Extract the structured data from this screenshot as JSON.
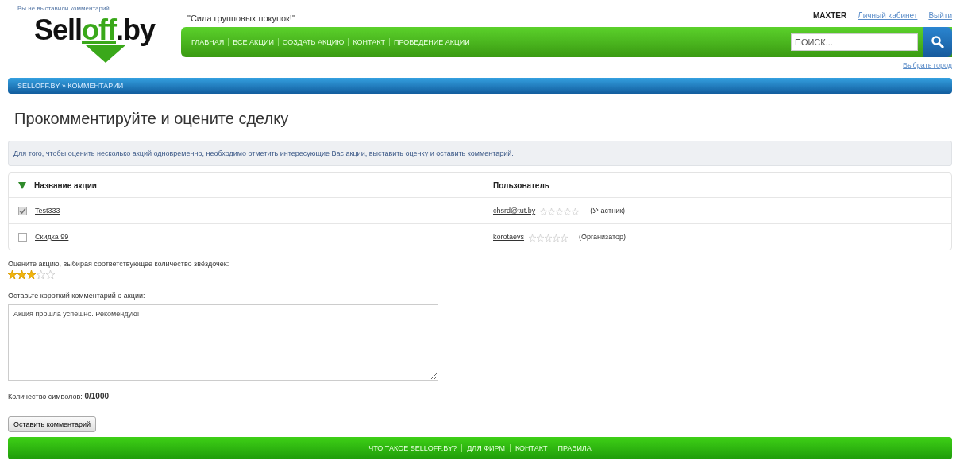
{
  "header": {
    "notice": "Вы не выставили комментарий",
    "logo": {
      "part_1": "Sell",
      "part_2": "off",
      "part_3": ".by"
    },
    "tagline": "\"Сила групповых покупок!\"",
    "nav": [
      "ГЛАВНАЯ",
      "ВСЕ АКЦИИ",
      "СОЗДАТЬ АКЦИЮ",
      "КОНТАКТ",
      "ПРОВЕДЕНИЕ АКЦИИ"
    ],
    "user": "MAXTER",
    "user_links": [
      "Личный кабинет",
      "Выйти"
    ],
    "search": {
      "placeholder": "ПОИСК..."
    },
    "city_link": "Выбрать город"
  },
  "breadcrumb": "SELLOFF.BY » КОММЕНТАРИИ",
  "page_title": "Прокомментируйте и оцените сделку",
  "info": "Для того, чтобы оценить несколько акций одновременно, необходимо отметить интересующие Вас акции, выставить оценку и оставить комментарий.",
  "table": {
    "columns": [
      "Название акции",
      "Пользователь"
    ],
    "rows": [
      {
        "checked": true,
        "deal": "Test333",
        "user": "chsrd@tut.by",
        "stars": 0,
        "role": "(Участник)"
      },
      {
        "checked": false,
        "deal": "Скидка 99",
        "user": "korotaevs",
        "stars": 0,
        "role": "(Организатор)"
      }
    ]
  },
  "rating": {
    "prompt": "Оцените акцию, выбирая соответствующее количество звёздочек:",
    "stars": 3
  },
  "comment": {
    "label": "Оставьте короткий комментарий о акции:",
    "placeholder": "Акция прошла успешно. Рекомендую!"
  },
  "counter": {
    "label": "Количество символов:",
    "value": "0/1000"
  },
  "submit_button": "Оставить комментарий",
  "footer": [
    "ЧТО ТАКОЕ SELLOFF.BY?",
    "ДЛЯ ФИРМ",
    "КОНТАКТ",
    "ПРАВИЛА"
  ]
}
